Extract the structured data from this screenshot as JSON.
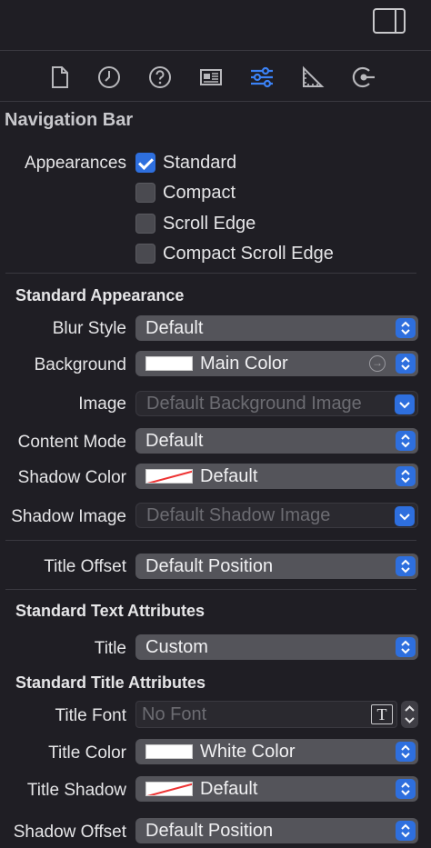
{
  "toolbar": {
    "panel_toggle_icon": "sidebar-right-icon",
    "tabs": [
      {
        "name": "file-inspector",
        "icon": "document-icon",
        "active": false
      },
      {
        "name": "history-inspector",
        "icon": "clock-icon",
        "active": false
      },
      {
        "name": "quick-help-inspector",
        "icon": "question-icon",
        "active": false
      },
      {
        "name": "identity-inspector",
        "icon": "id-card-icon",
        "active": false
      },
      {
        "name": "attributes-inspector",
        "icon": "sliders-icon",
        "active": true
      },
      {
        "name": "size-inspector",
        "icon": "ruler-icon",
        "active": false
      },
      {
        "name": "connections-inspector",
        "icon": "arrow-circle-icon",
        "active": false
      }
    ],
    "active_color": "#3b82f6"
  },
  "section_title": "Navigation Bar",
  "appearances": {
    "label": "Appearances",
    "options": [
      {
        "label": "Standard",
        "checked": true
      },
      {
        "label": "Compact",
        "checked": false
      },
      {
        "label": "Scroll Edge",
        "checked": false
      },
      {
        "label": "Compact Scroll Edge",
        "checked": false
      }
    ]
  },
  "standard_appearance": {
    "heading": "Standard Appearance",
    "blur_style": {
      "label": "Blur Style",
      "value": "Default"
    },
    "background": {
      "label": "Background",
      "value": "Main Color"
    },
    "image": {
      "label": "Image",
      "placeholder": "Default Background Image"
    },
    "content_mode": {
      "label": "Content Mode",
      "value": "Default"
    },
    "shadow_color": {
      "label": "Shadow Color",
      "value": "Default"
    },
    "shadow_image": {
      "label": "Shadow Image",
      "placeholder": "Default Shadow Image"
    },
    "title_offset": {
      "label": "Title Offset",
      "value": "Default Position"
    }
  },
  "standard_text_attributes": {
    "heading": "Standard Text Attributes",
    "title": {
      "label": "Title",
      "value": "Custom"
    }
  },
  "standard_title_attributes": {
    "heading": "Standard Title Attributes",
    "title_font": {
      "label": "Title Font",
      "placeholder": "No Font",
      "button": "T"
    },
    "title_color": {
      "label": "Title Color",
      "value": "White Color"
    },
    "title_shadow": {
      "label": "Title Shadow",
      "value": "Default"
    },
    "shadow_offset": {
      "label": "Shadow Offset",
      "value": "Default Position"
    }
  }
}
